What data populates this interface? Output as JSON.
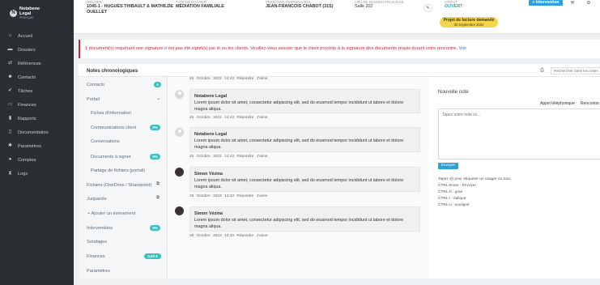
{
  "sidebar": {
    "logo_text": "Notabene",
    "logo_text2": "Legal",
    "logo_sub": "PRATIQUE",
    "items": [
      {
        "label": "Accueil",
        "icon": "home-icon"
      },
      {
        "label": "Dossiers",
        "icon": "folder-icon"
      },
      {
        "label": "Références",
        "icon": "handshake-icon"
      },
      {
        "label": "Contacts",
        "icon": "users-icon"
      },
      {
        "label": "Tâches",
        "icon": "check-icon"
      },
      {
        "label": "Finances",
        "icon": "card-icon"
      },
      {
        "label": "Rapports",
        "icon": "chart-icon"
      },
      {
        "label": "Documentation",
        "icon": "book-icon"
      },
      {
        "label": "Paramètres",
        "icon": "gear-icon"
      },
      {
        "label": "Comptes",
        "icon": "user-icon"
      },
      {
        "label": "Logs",
        "icon": "hourglass-icon"
      }
    ]
  },
  "header": {
    "labels": [
      "DOSSIER",
      "TYPE DE DOSSIER",
      "PERSONNE RESPONSABLE",
      "LIEU DE SESSION PRIVILÉGIÉ",
      "STATUT"
    ],
    "file": "1045-1 - HUGUES THIBAULT & MATHILDE OUELLET",
    "file_type": "MÉDIATION FAMILIALE",
    "responsible": "JEAN-FRANCOIS CHABOT (31S)",
    "room": "Salle 202",
    "status": "OUVERT",
    "intervention_button": "+ Intervention",
    "invoice_badge_title": "Projet de facture demandé",
    "invoice_badge_date": "30 Septembre 2024"
  },
  "alert": {
    "message": "1 document(s) requérant une signature n'ont pas été signé(s) par le ou les clients. Veuillez-vous assurer que le client procède à la signature des documents requis durant votre rencontre.",
    "link": "Voir"
  },
  "notes_panel": {
    "title": "Notes chronologiques",
    "search_placeholder": "Rechercher dans les notes"
  },
  "left_nav": {
    "contacts": "Contacts",
    "contacts_count": "4",
    "portail": "Portail",
    "fiches": "Fiches d'information",
    "communications": "Communications client",
    "communications_pct": "0%",
    "conversations": "Conversations",
    "documents_signer": "Documents à signer",
    "documents_pct": "0%",
    "partage": "Partage de fichiers (portail)",
    "fichiers": "Fichiers (OneDrive / Sharepoint)",
    "juriparole": "Juriparole",
    "ajouter_evenement": "+ Ajouter un événement",
    "interventions": "Interventions",
    "interventions_pct": "0%",
    "sondages": "Sondages",
    "finances": "Finances",
    "finances_amount": "0,00 $",
    "parametres": "Paramètres"
  },
  "notes": {
    "meta_top": "26 Octobre 2022 14:43   Répondre   J'aime",
    "items": [
      {
        "author": "Notabene Legal",
        "text": "Lorem ipsum dolor sit amet, consectetur adipiscing elit, sed do eiusmod tempor incididunt ut labore et dolore magna aliqua.",
        "meta": "26 Octobre 2022 14:43   Répondre   J'aime"
      },
      {
        "author": "Notabene Legal",
        "text": "Lorem ipsum dolor sit amet, consectetur adipiscing elit, sed do eiusmod tempor incididunt ut labore et dolore magna aliqua.",
        "meta": "26 Octobre 2022 14:43   Répondre   J'aime"
      },
      {
        "author": "Simon Vézina",
        "text": "Lorem ipsum dolor sit amet, consectetur adipiscing elit, sed do eiusmod tempor incididunt ut labore et dolore magna aliqua.",
        "meta": "26 Octobre 2022 14:43   Répondre   J'aime"
      },
      {
        "author": "Simon Vézina",
        "text": "Lorem ipsum dolor sit amet, consectetur adipiscing elit, sed do eiusmod tempor incididunt ut labore et dolore magna aliqua.",
        "meta": "26 Octobre 2022 14:43   Répondre   J'aime"
      }
    ]
  },
  "new_note": {
    "title": "Nouvelle note",
    "tab_call": "Appel téléphonique",
    "tab_meeting": "Rencontre",
    "placeholder": "Tapez votre note ici...",
    "send_button": "Envoyer",
    "help": [
      "Tapez @ pour étiqueter un usager ou tous",
      "CTRL-Enter : Envoyer",
      "CTRL-b : gras",
      "CTRL-i : italique",
      "CTRL-u : souligné"
    ]
  },
  "colors": {
    "sidebar_bg": "#2b2f33",
    "accent": "#2e9fd8",
    "badge": "#38c1c1",
    "alert": "#c12a3e",
    "invoice_badge": "#f4d44a"
  }
}
